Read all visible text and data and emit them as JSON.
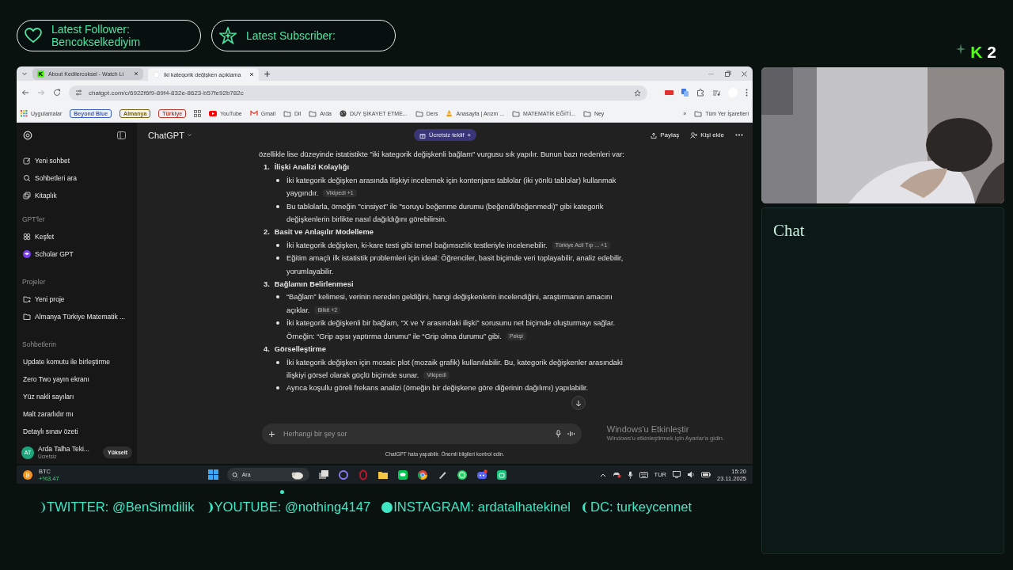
{
  "alerts": [
    {
      "kind": "follower",
      "label": "Latest Follower:",
      "value": "Bencokselkediyim"
    },
    {
      "kind": "subscriber",
      "label": "Latest Subscriber:"
    }
  ],
  "logo": {
    "letter": "K",
    "number": "2"
  },
  "browser": {
    "tabs": [
      {
        "title": "About Kedilercoksel - Watch Li",
        "selected": false
      },
      {
        "title": "İki kategorik değişken açıklama",
        "selected": true
      }
    ],
    "url": "chatgpt.com/c/6922f6f9-89f4-832e-8623-b57fe92b782c",
    "bookmarks": [
      {
        "kind": "apps",
        "label": "Uygulamalar"
      },
      {
        "kind": "tag",
        "label": "Beyond Blue",
        "color": "#3a5fc4"
      },
      {
        "kind": "tag",
        "label": "Almanya",
        "color": "#7a6508"
      },
      {
        "kind": "tag",
        "label": "Türkiye",
        "color": "#c0392b"
      },
      {
        "kind": "grid"
      },
      {
        "kind": "video",
        "label": "YouTube"
      },
      {
        "kind": "mail",
        "label": "Gmail"
      },
      {
        "kind": "folder",
        "label": "Dil"
      },
      {
        "kind": "folder",
        "label": "Arda"
      },
      {
        "kind": "globe",
        "label": "DUY ŞİKAYET ETME..."
      },
      {
        "kind": "folder",
        "label": "Ders"
      },
      {
        "kind": "cone",
        "label": "Anasayfa | Arızm ..."
      },
      {
        "kind": "folder",
        "label": "MATEMATİK EĞİTİ..."
      },
      {
        "kind": "folder",
        "label": "Ney"
      }
    ],
    "overflow": "»",
    "all_bookmarks": "Tüm Yer İşaretleri"
  },
  "chatgpt": {
    "sidebar": {
      "groups": [
        {
          "items": [
            {
              "kind": "new-chat",
              "label": "Yeni sohbet"
            },
            {
              "kind": "search",
              "label": "Sohbetleri ara"
            },
            {
              "kind": "library",
              "label": "Kitaplık"
            }
          ]
        },
        {
          "heading": "GPT'ler",
          "items": [
            {
              "kind": "explore",
              "label": "Keşfet"
            },
            {
              "kind": "gpt",
              "label": "Scholar GPT"
            }
          ]
        },
        {
          "heading": "Projeler",
          "items": [
            {
              "kind": "new-project",
              "label": "Yeni proje"
            },
            {
              "kind": "folder",
              "label": "Almanya Türkiye Matematik ..."
            }
          ]
        },
        {
          "heading": "Sohbetlerin",
          "items": [
            {
              "kind": "chat",
              "label": "Update komutu ile birleştirme"
            },
            {
              "kind": "chat",
              "label": "Zero Two yayın ekranı"
            },
            {
              "kind": "chat",
              "label": "Yüz nakli sayıları"
            },
            {
              "kind": "chat",
              "label": "Malt zararlıdır mı"
            },
            {
              "kind": "chat",
              "label": "Detaylı sınav özeti"
            }
          ]
        }
      ],
      "user": {
        "initials": "AT",
        "name": "Arda Talha Teki...",
        "plan": "Ücretsiz",
        "upgrade": "Yükselt"
      }
    },
    "header": {
      "model": "ChatGPT",
      "offer": "Ücretsiz teklif",
      "close": "×",
      "share": "Paylaş",
      "add_person": "Kişi ekle"
    },
    "message": {
      "intro": "özellikle lise düzeyinde istatistikte \"iki kategorik değişkenli bağlam\" vurgusu sık yapılır. Bunun bazı nedenleri var:",
      "sections": [
        {
          "number": "1.",
          "title": "İlişki Analizi Kolaylığı",
          "bullets": [
            {
              "text": "İki kategorik değişken arasında ilişkiyi incelemek için kontenjans tablolar (iki yönlü tablolar) kullanmak yaygındır.",
              "source": {
                "name": "Vikipedi",
                "more": "+1"
              }
            },
            {
              "text": "Bu tablolarla, örneğin \"cinsiyet\" ile \"soruyu beğenme durumu (beğendi/beğenmedi)\" gibi kategorik değişkenlerin birlikte nasıl dağıldığını görebilirsin."
            }
          ]
        },
        {
          "number": "2.",
          "title": "Basit ve Anlaşılır Modelleme",
          "bullets": [
            {
              "text": "İki kategorik değişken, ki-kare testi gibi temel bağımsızlık testleriyle incelenebilir.",
              "source": {
                "name": "Türkiye Acil Tıp ...",
                "more": "+1"
              }
            },
            {
              "text": "Eğitim amaçlı ilk istatistik problemleri için ideal: Öğrenciler, basit biçimde veri toplayabilir, analiz edebilir, yorumlayabilir."
            }
          ]
        },
        {
          "number": "3.",
          "title": "Bağlamın Belirlenmesi",
          "bullets": [
            {
              "text": "“Bağlam” kelimesi, verinin nereden geldiğini, hangi değişkenlerin incelendiğini, araştırmanın amacını açıklar.",
              "source": {
                "name": "Bilkit",
                "more": "+2"
              }
            },
            {
              "text": "İki kategorik değişkenli bir bağlam, “X ve Y arasındaki ilişki” sorusunu net biçimde oluşturmayı sağlar. Örneğin: “Grip aşısı yaptırma durumu” ile “Grip olma durumu” gibi.",
              "source": {
                "name": "Pekşi"
              }
            }
          ]
        },
        {
          "number": "4.",
          "title": "Görselleştirme",
          "bullets": [
            {
              "text": "İki kategorik değişken için mosaic plot (mozaik grafik) kullanılabilir. Bu, kategorik değişkenler arasındaki ilişkiyi görsel olarak güçlü biçimde sunar.",
              "source": {
                "name": "Vikipedi"
              }
            },
            {
              "text": "Ayrıca koşullu göreli frekans analizi (örneğin bir değişkene göre diğerinin dağılımı) yapılabilir."
            }
          ]
        }
      ]
    },
    "composer": {
      "placeholder": "Herhangi bir şey sor"
    },
    "disclaimer": "ChatGPT hata yapabilir. Önemli bilgileri kontrol edin."
  },
  "activation": {
    "title": "Windows'u Etkinleştir",
    "text": "Windows'u etkinleştirmek için Ayarlar'a gidin."
  },
  "taskbar": {
    "ticker": {
      "symbol": "BTC",
      "change": "+%3.47"
    },
    "search": "Ara",
    "language": "TUR",
    "time": "15:20",
    "date": "23.11.2025"
  },
  "socials": [
    {
      "kind": "crescent",
      "text": "TWITTER: @BenSimdilik"
    },
    {
      "kind": "half",
      "text": "YOUTUBE: @nothing4147"
    },
    {
      "kind": "full",
      "text": "INSTAGRAM: ardatalhatekinel"
    },
    {
      "kind": "crescent-left",
      "text": "DC: turkeycennet"
    }
  ],
  "chat": {
    "title": "Chat"
  }
}
